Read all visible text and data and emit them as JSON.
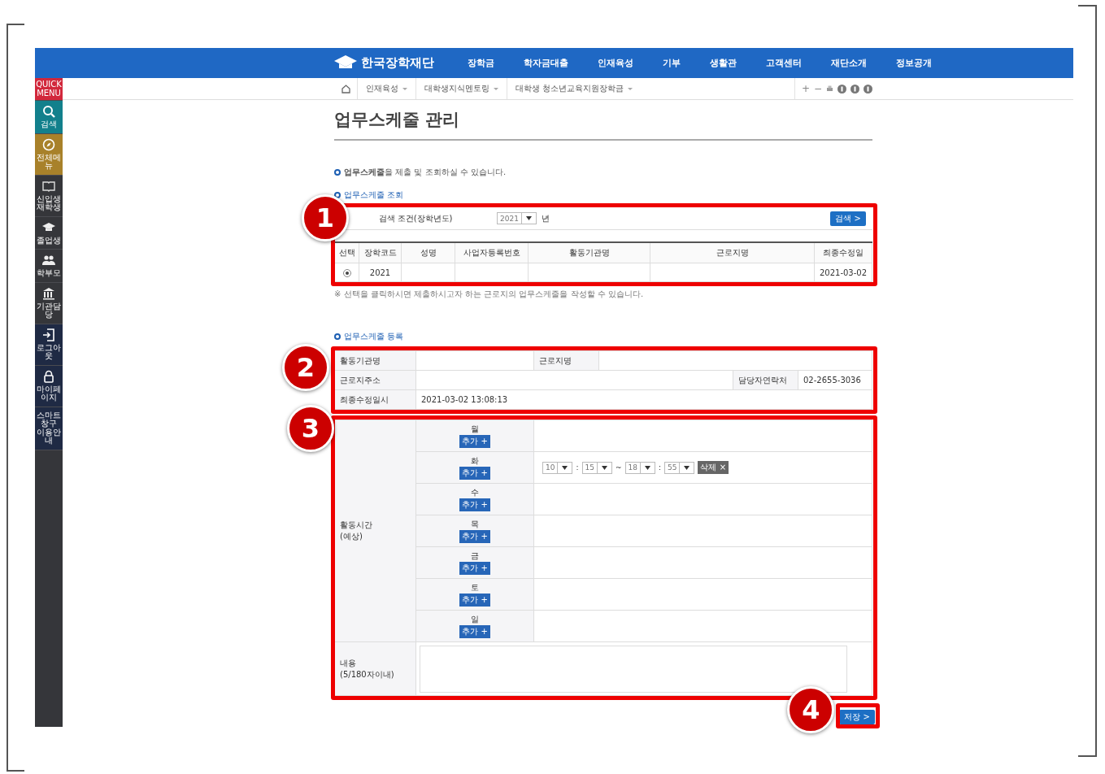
{
  "header": {
    "logo": "한국장학재단",
    "nav": [
      "장학금",
      "학자금대출",
      "인재육성",
      "기부",
      "생활관",
      "고객센터",
      "재단소개",
      "정보공개"
    ]
  },
  "breadcrumb": [
    "인재육성",
    "대학생지식멘토링",
    "대학생 청소년교육지원장학금"
  ],
  "zoom_controls": [
    "+",
    "−"
  ],
  "sidebar": [
    {
      "label": "QUICK MENU",
      "kind": "quick",
      "color": "#d2283c"
    },
    {
      "label": "검색",
      "kind": "search",
      "color": "#12808c"
    },
    {
      "label": "전체메뉴",
      "kind": "compass",
      "color": "#a8812a"
    },
    {
      "label": "신입생 재학생",
      "kind": "book",
      "color": "#35363a"
    },
    {
      "label": "졸업생",
      "kind": "cap",
      "color": "#35363a"
    },
    {
      "label": "학부모",
      "kind": "people",
      "color": "#35363a"
    },
    {
      "label": "기관담당",
      "kind": "building",
      "color": "#35363a"
    },
    {
      "label": "로그아웃",
      "kind": "logout",
      "color": "#1f2a44"
    },
    {
      "label": "마이페이지",
      "kind": "lock",
      "color": "#1f2a44"
    },
    {
      "label": "스마트 창구 이용안내",
      "kind": "text",
      "color": "#1f2a44"
    }
  ],
  "page_title": "업무스케줄 관리",
  "intro": "**업무스케줄**을 제출 및 조회하실 수 있습니다.",
  "lookup": {
    "title": "업무스케줄 조회",
    "search_label": "검색 조건(장학년도)",
    "year": "2021",
    "year_unit": "년",
    "search_button": "검색 >",
    "columns": [
      "선택",
      "장학코드",
      "성명",
      "사업자등록번호",
      "활동기관명",
      "근로지명",
      "최종수정일"
    ],
    "rows": [
      {
        "selected": true,
        "code": "2021",
        "modified": "2021-03-02"
      }
    ],
    "note": "※ 선택을 클릭하시면 제출하시고자 하는 근로지의 업무스케줄을 작성할 수 있습니다."
  },
  "register": {
    "title": "업무스케줄 등록",
    "fields": [
      {
        "label": "활동기관명"
      },
      {
        "label": "근로지명"
      },
      {
        "label": "근로지주소"
      },
      {
        "label": "담당자연락처",
        "value": "02-2655-3036"
      },
      {
        "label": "최종수정일시",
        "value": "2021-03-02 13:08:13"
      }
    ],
    "schedule_label": "활동시간",
    "schedule_sublabel": "(예상)",
    "days": [
      {
        "day": "월",
        "add": "추가 +"
      },
      {
        "day": "화",
        "add": "추가 +",
        "slots": [
          {
            "start_h": "10",
            "start_m": "15",
            "end_h": "18",
            "end_m": "55",
            "time_sep": ":",
            "range_sep": "~",
            "delete": "삭제 ×"
          }
        ]
      },
      {
        "day": "수",
        "add": "추가 +"
      },
      {
        "day": "목",
        "add": "추가 +"
      },
      {
        "day": "금",
        "add": "추가 +"
      },
      {
        "day": "토",
        "add": "추가 +"
      },
      {
        "day": "일",
        "add": "추가 +"
      }
    ],
    "content_label": "내용",
    "content_sublabel": "(5/180자이내)",
    "save_button": "저장 >"
  },
  "annotations": [
    {
      "label": "1"
    },
    {
      "label": "2"
    },
    {
      "label": "3"
    },
    {
      "label": "4"
    }
  ]
}
